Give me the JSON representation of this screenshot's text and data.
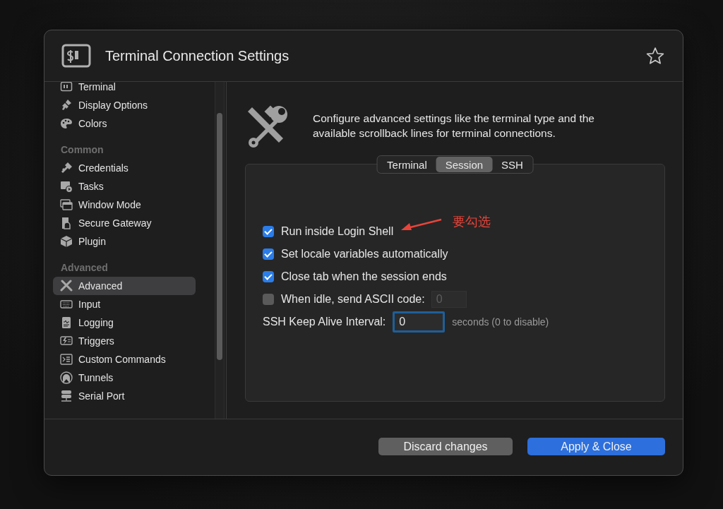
{
  "window": {
    "title": "Terminal Connection Settings",
    "favorite": false
  },
  "sidebar": {
    "sections": [
      {
        "items": [
          {
            "label": "Terminal",
            "selected": false
          },
          {
            "label": "Display Options",
            "selected": false
          },
          {
            "label": "Colors",
            "selected": false
          }
        ]
      },
      {
        "heading": "Common",
        "items": [
          {
            "label": "Credentials",
            "selected": false
          },
          {
            "label": "Tasks",
            "selected": false
          },
          {
            "label": "Window Mode",
            "selected": false
          },
          {
            "label": "Secure Gateway",
            "selected": false
          },
          {
            "label": "Plugin",
            "selected": false
          }
        ]
      },
      {
        "heading": "Advanced",
        "items": [
          {
            "label": "Advanced",
            "selected": true
          },
          {
            "label": "Input",
            "selected": false
          },
          {
            "label": "Logging",
            "selected": false
          },
          {
            "label": "Triggers",
            "selected": false
          },
          {
            "label": "Custom Commands",
            "selected": false
          },
          {
            "label": "Tunnels",
            "selected": false
          },
          {
            "label": "Serial Port",
            "selected": false
          }
        ]
      }
    ]
  },
  "description": "Configure advanced settings like the terminal type and the available scrollback lines for terminal connections.",
  "tabs": [
    {
      "label": "Terminal",
      "selected": false
    },
    {
      "label": "Session",
      "selected": true
    },
    {
      "label": "SSH",
      "selected": false
    }
  ],
  "options": [
    {
      "kind": "checkbox",
      "label": "Run inside Login Shell",
      "checked": true
    },
    {
      "kind": "checkbox",
      "label": "Set locale variables automatically",
      "checked": true
    },
    {
      "kind": "checkbox",
      "label": "Close tab when the session ends",
      "checked": true
    },
    {
      "kind": "checkbox-field",
      "label": "When idle, send ASCII code:",
      "checked": false,
      "field": {
        "value": "0",
        "disabled": true
      }
    }
  ],
  "keep_alive": {
    "label": "SSH Keep Alive Interval:",
    "value": "0",
    "focused": true,
    "suffix": "seconds (0 to disable)"
  },
  "annotation": {
    "text": "要勾选"
  },
  "buttons": [
    {
      "kind": "secondary",
      "label": "Discard changes"
    },
    {
      "kind": "primary",
      "label": "Apply & Close"
    }
  ]
}
